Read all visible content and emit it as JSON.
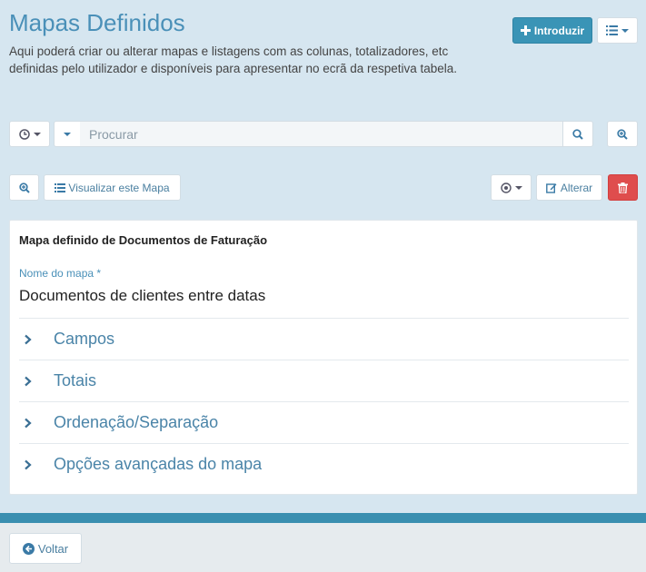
{
  "header": {
    "title": "Mapas Definidos",
    "description": "Aqui poderá criar ou alterar mapas e listagens com as colunas, totalizadores, etc definidas pelo utilizador e disponíveis para apresentar no ecrã da respetiva tabela.",
    "introduce_label": "Introduzir"
  },
  "search": {
    "placeholder": "Procurar"
  },
  "toolbar": {
    "view_map_label": "Visualizar este Mapa",
    "edit_label": "Alterar"
  },
  "panel": {
    "title": "Mapa definido de Documentos de Faturação",
    "name_label": "Nome do mapa *",
    "name_value": "Documentos de clientes entre datas",
    "sections": [
      {
        "label": "Campos"
      },
      {
        "label": "Totais"
      },
      {
        "label": "Ordenação/Separação"
      },
      {
        "label": "Opções avançadas do mapa"
      }
    ]
  },
  "footer": {
    "back_label": "Voltar"
  },
  "colors": {
    "primary": "#3a94b6",
    "danger": "#df4d4d",
    "background": "#d6e6f0",
    "title": "#4a90b8"
  }
}
